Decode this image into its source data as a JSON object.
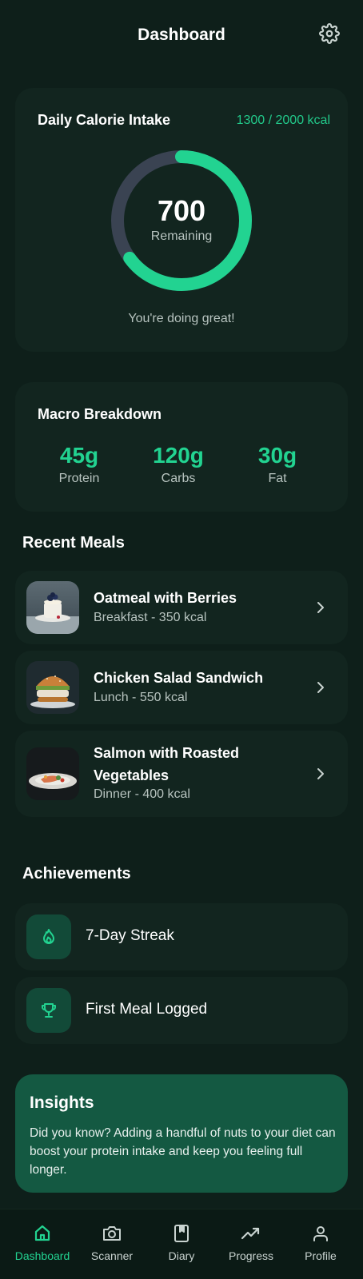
{
  "header": {
    "title": "Dashboard"
  },
  "calorie": {
    "title": "Daily Calorie Intake",
    "summary": "1300 / 2000 kcal",
    "consumed": 1300,
    "goal": 2000,
    "remaining_value": "700",
    "remaining_label": "Remaining",
    "message": "You're doing great!"
  },
  "macros": {
    "title": "Macro Breakdown",
    "items": [
      {
        "value": "45g",
        "label": "Protein"
      },
      {
        "value": "120g",
        "label": "Carbs"
      },
      {
        "value": "30g",
        "label": "Fat"
      }
    ]
  },
  "recent_meals": {
    "title": "Recent Meals",
    "items": [
      {
        "name": "Oatmeal with Berries",
        "detail": "Breakfast - 350 kcal"
      },
      {
        "name": "Chicken Salad Sandwich",
        "detail": "Lunch - 550 kcal"
      },
      {
        "name": "Salmon with Roasted Vegetables",
        "detail": "Dinner - 400 kcal"
      }
    ]
  },
  "achievements": {
    "title": "Achievements",
    "items": [
      {
        "label": "7-Day Streak",
        "icon": "flame-icon"
      },
      {
        "label": "First Meal Logged",
        "icon": "trophy-icon"
      }
    ]
  },
  "insights": {
    "title": "Insights",
    "text": "Did you know? Adding a handful of nuts to your diet can boost your protein intake and keep you feeling full longer."
  },
  "nav": {
    "items": [
      {
        "label": "Dashboard",
        "icon": "home-icon",
        "active": true
      },
      {
        "label": "Scanner",
        "icon": "camera-icon",
        "active": false
      },
      {
        "label": "Diary",
        "icon": "book-icon",
        "active": false
      },
      {
        "label": "Progress",
        "icon": "trending-up-icon",
        "active": false
      },
      {
        "label": "Profile",
        "icon": "user-icon",
        "active": false
      }
    ]
  },
  "colors": {
    "background": "#0e1f1a",
    "card": "#12251f",
    "accent": "#22d391",
    "ring_track": "#3a4352",
    "insights_bg": "#145942"
  }
}
